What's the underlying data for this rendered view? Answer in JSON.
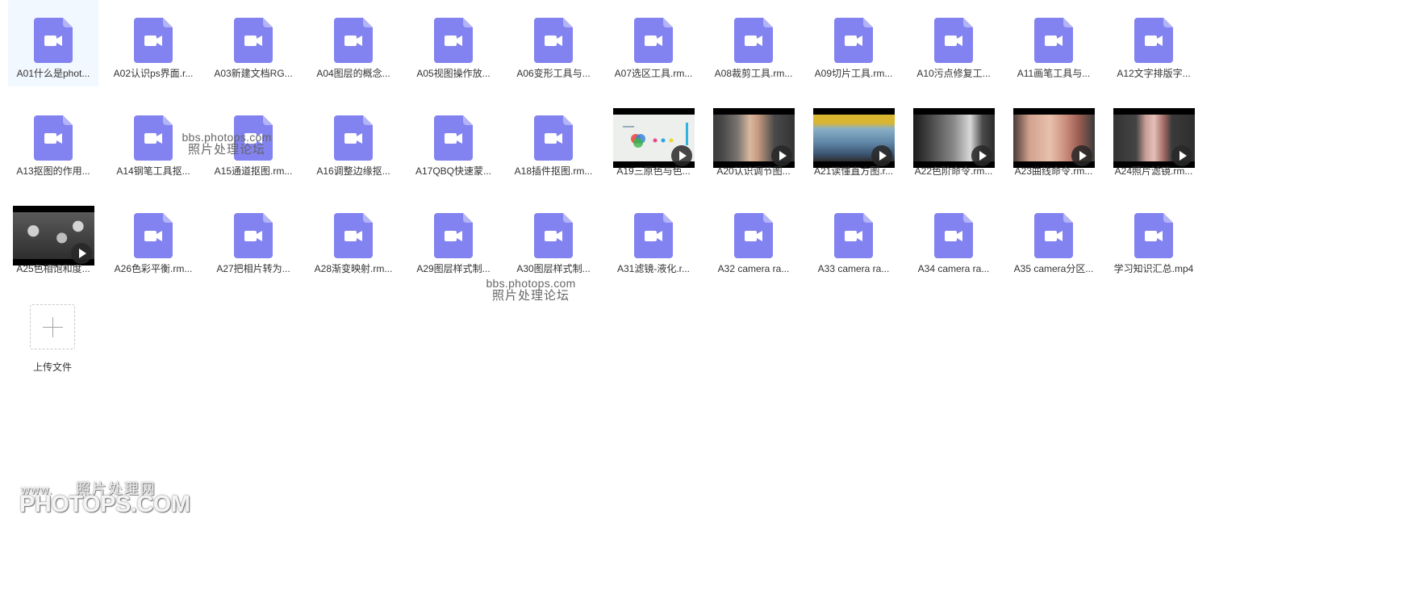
{
  "files": [
    {
      "name": "A01什么是phot...",
      "kind": "doc",
      "selected": true
    },
    {
      "name": "A02认识ps界面.r...",
      "kind": "doc"
    },
    {
      "name": "A03新建文档RG...",
      "kind": "doc"
    },
    {
      "name": "A04图层的概念...",
      "kind": "doc"
    },
    {
      "name": "A05视图操作放...",
      "kind": "doc"
    },
    {
      "name": "A06变形工具与...",
      "kind": "doc"
    },
    {
      "name": "A07选区工具.rm...",
      "kind": "doc"
    },
    {
      "name": "A08裁剪工具.rm...",
      "kind": "doc"
    },
    {
      "name": "A09切片工具.rm...",
      "kind": "doc"
    },
    {
      "name": "A10污点修复工...",
      "kind": "doc"
    },
    {
      "name": "A11画笔工具与...",
      "kind": "doc"
    },
    {
      "name": "A12文字排版字...",
      "kind": "doc"
    },
    {
      "name": "A13抠图的作用...",
      "kind": "doc"
    },
    {
      "name": "A14钢笔工具抠...",
      "kind": "doc"
    },
    {
      "name": "A15通道抠图.rm...",
      "kind": "doc"
    },
    {
      "name": "A16调整边缘抠...",
      "kind": "doc"
    },
    {
      "name": "A17QBQ快速蒙...",
      "kind": "doc"
    },
    {
      "name": "A18插件抠图.rm...",
      "kind": "doc"
    },
    {
      "name": "A19三原色与色...",
      "kind": "video",
      "thumb": "rgb-circles"
    },
    {
      "name": "A20认识调节图...",
      "kind": "video",
      "thumb": "portrait-editor"
    },
    {
      "name": "A21读懂直方图.r...",
      "kind": "video",
      "thumb": "landscape-yellow"
    },
    {
      "name": "A22色阶命令.rm...",
      "kind": "video",
      "thumb": "grayscale-gradient"
    },
    {
      "name": "A23曲线命令.rm...",
      "kind": "video",
      "thumb": "face-closeup"
    },
    {
      "name": "A24照片滤镜.rm...",
      "kind": "video",
      "thumb": "portrait-filter"
    },
    {
      "name": "A25色相饱和度...",
      "kind": "video",
      "thumb": "flowers-bw"
    },
    {
      "name": "A26色彩平衡.rm...",
      "kind": "doc"
    },
    {
      "name": "A27把相片转为...",
      "kind": "doc"
    },
    {
      "name": "A28渐变映射.rm...",
      "kind": "doc"
    },
    {
      "name": "A29图层样式制...",
      "kind": "doc"
    },
    {
      "name": "A30图层样式制...",
      "kind": "doc"
    },
    {
      "name": "A31滤镜-液化.r...",
      "kind": "doc"
    },
    {
      "name": "A32 camera ra...",
      "kind": "doc"
    },
    {
      "name": "A33 camera ra...",
      "kind": "doc"
    },
    {
      "name": "A34 camera ra...",
      "kind": "doc"
    },
    {
      "name": "A35 camera分区...",
      "kind": "doc"
    },
    {
      "name": "学习知识汇总.mp4",
      "kind": "doc"
    }
  ],
  "upload": {
    "label": "上传文件"
  },
  "watermarks": [
    {
      "line1": "bbs.photops.com",
      "line2": "照片处理论坛"
    },
    {
      "line1": "bbs.photops.com",
      "line2": "照片处理论坛"
    }
  ],
  "logo": {
    "prefix": "www.",
    "cn": "照片处理网",
    "brand": "PHOTOPS.COM"
  },
  "colors": {
    "doc_icon": "#8282f0",
    "doc_fold": "#b3b3f7",
    "selected_bg": "#f2f8ff"
  },
  "icons": {
    "doc": "video-file-icon",
    "play": "play-icon",
    "upload": "plus-icon"
  }
}
